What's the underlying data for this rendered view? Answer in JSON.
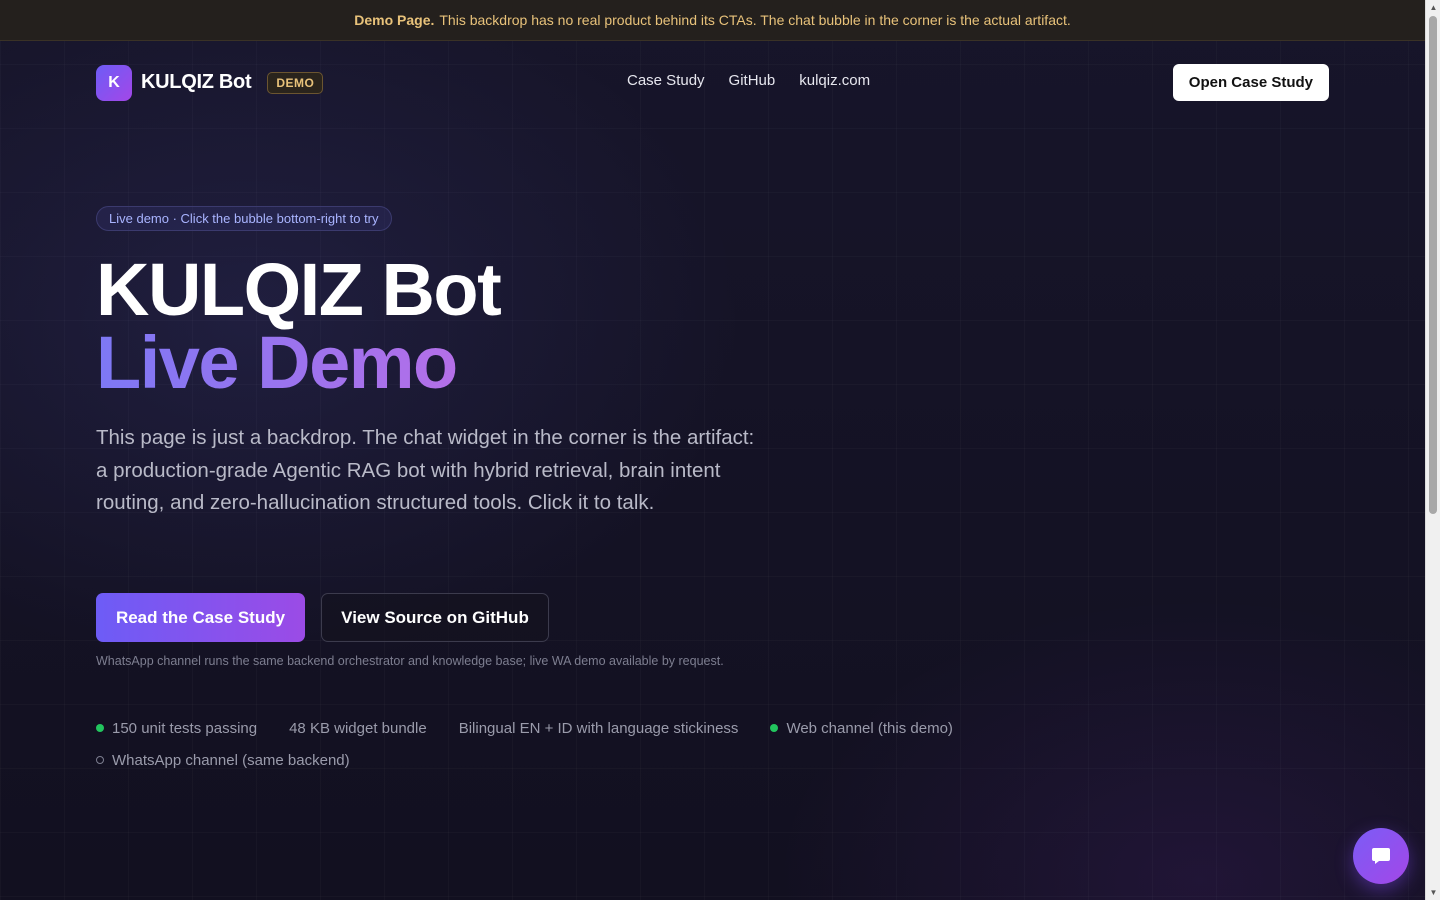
{
  "banner": {
    "bold": "Demo Page.",
    "text": "This backdrop has no real product behind its CTAs. The chat bubble in the corner is the actual artifact."
  },
  "nav": {
    "logo_letter": "K",
    "brand": "KULQIZ Bot",
    "badge": "DEMO",
    "links": [
      "Case Study",
      "GitHub",
      "kulqiz.com"
    ],
    "cta": "Open Case Study"
  },
  "hero": {
    "pill": "Live demo · Click the bubble bottom-right to try",
    "title_line1": "KULQIZ Bot",
    "title_line2": "Live Demo",
    "lead": "This page is just a backdrop. The chat widget in the corner is the artifact: a production-grade Agentic RAG bot with hybrid retrieval, brain intent routing, and zero-hallucination structured tools. Click it to talk.",
    "primary_cta": "Read the Case Study",
    "secondary_cta": "View Source on GitHub",
    "note": "WhatsApp channel runs the same backend orchestrator and knowledge base; live WA demo available by request."
  },
  "stats": [
    {
      "label": "150 unit tests passing",
      "dot": "green"
    },
    {
      "label": "48 KB widget bundle",
      "dot": "none"
    },
    {
      "label": "Bilingual EN + ID with language stickiness",
      "dot": "none"
    },
    {
      "label": "Web channel (this demo)",
      "dot": "green"
    },
    {
      "label": "WhatsApp channel (same backend)",
      "dot": "hollow"
    }
  ],
  "colors": {
    "accent_start": "#6d5cf6",
    "accent_end": "#a347e8",
    "banner_text": "#e8c27a",
    "status_green": "#22c55e"
  },
  "icons": {
    "chat_bubble": "chat-icon"
  }
}
